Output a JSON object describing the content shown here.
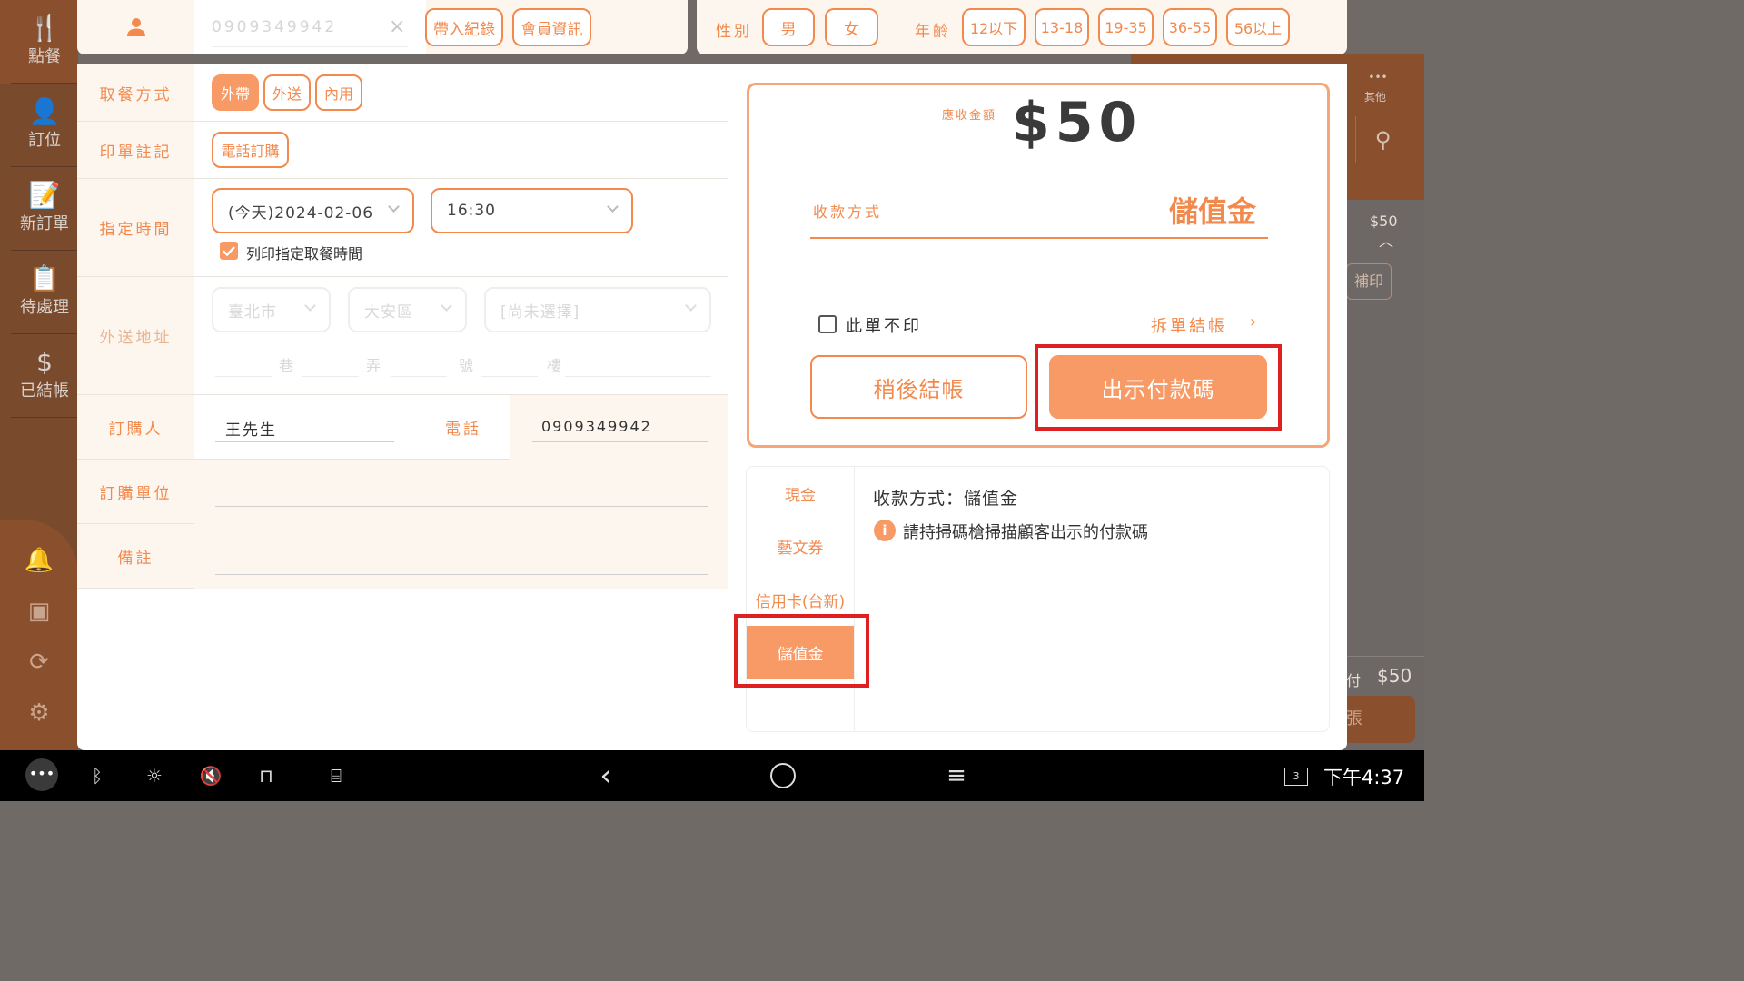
{
  "bg": {
    "sidebar_items": [
      {
        "icon": "🍴",
        "label": "點餐"
      },
      {
        "icon": "👤",
        "label": "訂位"
      },
      {
        "icon": "📝",
        "label": "新訂單"
      },
      {
        "icon": "📋",
        "label": "待處理"
      },
      {
        "icon": "$",
        "label": "已結帳"
      }
    ],
    "right_other": "其他",
    "right_amount": "$50",
    "right_reprint": "補印",
    "right_total_label": "付",
    "right_total": "$50"
  },
  "header": {
    "phone_placeholder": "0909349942",
    "clear_icon": "×",
    "import_record_label": "帶入紀錄",
    "member_info_label": "會員資訊",
    "gender_label": "性別",
    "gender_options": [
      "男",
      "女"
    ],
    "age_label": "年齡",
    "age_options": [
      "12以下",
      "13-18",
      "19-35",
      "36-55",
      "56以上"
    ]
  },
  "form": {
    "pickup_label": "取餐方式",
    "pickup_options": [
      "外帶",
      "外送",
      "內用"
    ],
    "print_note_label": "印單註記",
    "print_note_options": [
      "電話訂購"
    ],
    "time_label": "指定時間",
    "date_value": "(今天)2024-02-06",
    "time_value": "16:30",
    "print_time_label": "列印指定取餐時間",
    "address_label": "外送地址",
    "city": "臺北市",
    "district": "大安區",
    "road": "[尚未選擇]",
    "address_parts": [
      "巷",
      "弄",
      "號",
      "樓"
    ],
    "orderer_label": "訂購人",
    "orderer_value": "王先生",
    "phone_label": "電話",
    "phone_value": "0909349942",
    "unit_label": "訂購單位",
    "note_label": "備註"
  },
  "payment": {
    "due_label": "應收金額",
    "due_amount": "$50",
    "method_label": "收款方式",
    "method_value": "儲值金",
    "no_print_label": "此單不印",
    "split_label": "拆單結帳",
    "later_label": "稍後結帳",
    "show_code_label": "出示付款碼",
    "methods": [
      "現金",
      "藝文券",
      "信用卡(台新)",
      "儲值金"
    ],
    "detail_title": "收款方式：儲值金",
    "detail_info": "請持掃碼槍掃描顧客出示的付款碼"
  },
  "navbar": {
    "clock": "下午4:37",
    "badge": "3"
  },
  "colors": {
    "accent": "#f28a4e",
    "accent_fill": "#f79a65",
    "highlight": "#e02020",
    "panel_bg": "#fdf6ef"
  }
}
